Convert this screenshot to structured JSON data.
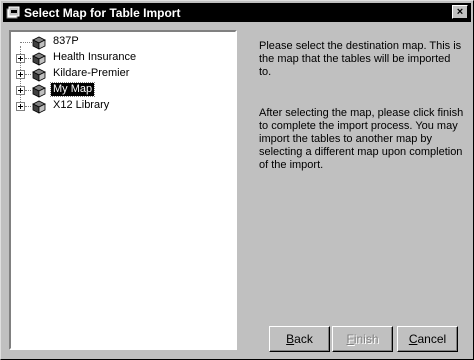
{
  "window": {
    "title": "Select Map for Table Import",
    "close_label": "×"
  },
  "tree": {
    "items": [
      {
        "label": "837P",
        "expandable": false,
        "selected": false
      },
      {
        "label": "Health Insurance",
        "expandable": true,
        "selected": false
      },
      {
        "label": "Kildare-Premier",
        "expandable": true,
        "selected": false
      },
      {
        "label": "My Map",
        "expandable": true,
        "selected": true
      },
      {
        "label": "X12 Library",
        "expandable": true,
        "selected": false
      }
    ]
  },
  "instructions": {
    "paragraph1": "Please select the destination map.  This is the map that the tables will be imported to.",
    "paragraph2": "After selecting the map, please click finish to complete the import process.  You may import the tables to another map by selecting a different map upon completion of the import."
  },
  "buttons": {
    "back": {
      "label": "Back",
      "mnemonic": "B",
      "rest": "ack",
      "enabled": true
    },
    "finish": {
      "label": "Finish",
      "mnemonic": "F",
      "rest": "inish",
      "enabled": false
    },
    "cancel": {
      "label": "Cancel",
      "mnemonic": "C",
      "rest": "ancel",
      "enabled": true
    }
  }
}
